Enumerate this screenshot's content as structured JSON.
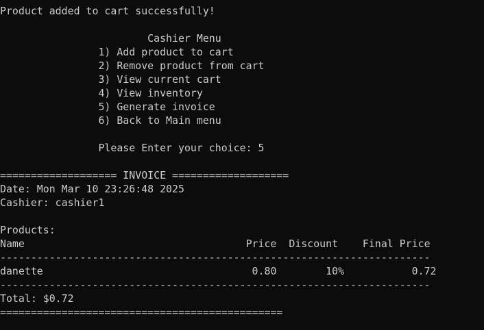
{
  "terminal": {
    "background": "#0c0c0c",
    "foreground": "#cccccc",
    "lines": [
      "Product added to cart successfully!",
      "",
      "                        Cashier Menu",
      "                1) Add product to cart",
      "                2) Remove product from cart",
      "                3) View current cart",
      "                4) View inventory",
      "                5) Generate invoice",
      "                6) Back to Main menu",
      "",
      "                Please Enter your choice: 5",
      "",
      "=================== INVOICE ===================",
      "Date: Mon Mar 10 23:26:48 2025",
      "Cashier: cashier1",
      "",
      "Products:",
      "Name                                    Price  Discount    Final Price",
      "----------------------------------------------------------------------",
      "danette                                  0.80        10%           0.72",
      "----------------------------------------------------------------------",
      "Total: $0.72",
      "=============================================="
    ]
  }
}
